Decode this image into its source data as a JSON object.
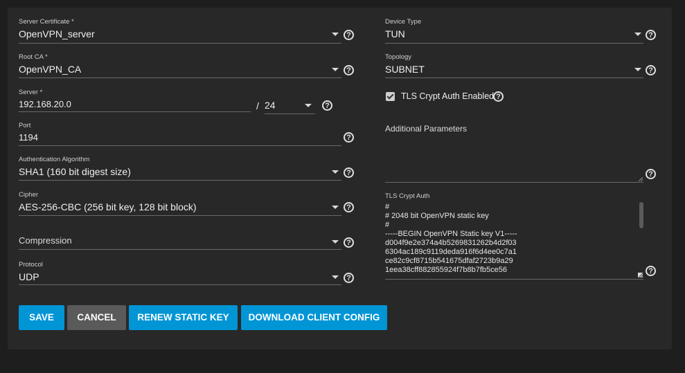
{
  "left": {
    "server_certificate": {
      "label": "Server Certificate *",
      "value": "OpenVPN_server"
    },
    "root_ca": {
      "label": "Root CA *",
      "value": "OpenVPN_CA"
    },
    "server": {
      "label": "Server *",
      "value": "192.168.20.0",
      "separator": "/",
      "netmask": "24"
    },
    "port": {
      "label": "Port",
      "value": "1194"
    },
    "auth_algorithm": {
      "label": "Authentication Algorithm",
      "value": "SHA1 (160 bit digest size)"
    },
    "cipher": {
      "label": "Cipher",
      "value": "AES-256-CBC (256 bit key, 128 bit block)"
    },
    "compression": {
      "placeholder": "Compression"
    },
    "protocol": {
      "label": "Protocol",
      "value": "UDP"
    }
  },
  "right": {
    "device_type": {
      "label": "Device Type",
      "value": "TUN"
    },
    "topology": {
      "label": "Topology",
      "value": "SUBNET"
    },
    "tls_crypt_auth_enabled": {
      "label": "TLS Crypt Auth Enabled",
      "checked": true
    },
    "additional_parameters": {
      "label": "Additional Parameters",
      "value": ""
    },
    "tls_crypt_auth": {
      "label": "TLS Crypt Auth",
      "value": "#\n# 2048 bit OpenVPN static key\n#\n-----BEGIN OpenVPN Static key V1-----\nd004f9e2e374a4b5269831262b4d2f03\n6304ac189c9119deda916f6d4ee0c7a1\nce82c9cf8715b541675dfaf2723b9a29\n1eea38cff882855924f7b8b7fb5ce56"
    }
  },
  "buttons": {
    "save": "SAVE",
    "cancel": "CANCEL",
    "renew": "RENEW STATIC KEY",
    "download": "DOWNLOAD CLIENT CONFIG"
  },
  "help_glyph": "?",
  "colors": {
    "accent": "#0095d5",
    "panel": "#282828",
    "background": "#1e1e1e",
    "cancel": "#5a5a5a"
  },
  "icons": [
    "help-circle-icon",
    "dropdown-caret-icon",
    "checkbox-check-icon",
    "resize-handle-icon"
  ]
}
